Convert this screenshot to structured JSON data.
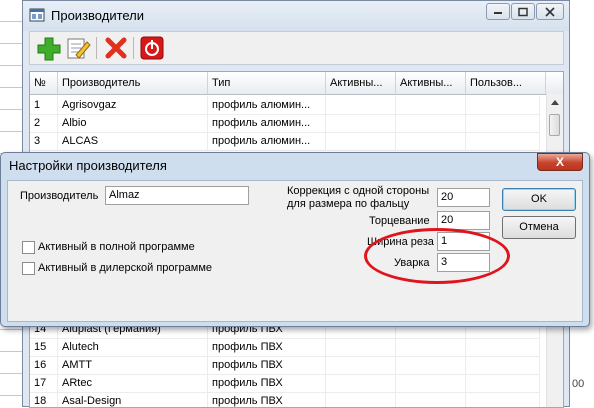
{
  "main_window": {
    "title": "Производители",
    "colors": {
      "title_bar": "#dfe8f2",
      "dialog_close": "#c7432c",
      "highlight_ellipse": "#e0141c"
    },
    "toolbar": {
      "buttons": [
        {
          "name": "add-icon"
        },
        {
          "name": "edit-icon"
        },
        {
          "name": "delete-icon"
        },
        {
          "name": "power-icon"
        }
      ]
    },
    "grid": {
      "columns": [
        "№",
        "Производитель",
        "Тип",
        "Активны...",
        "Активны...",
        "Пользов..."
      ],
      "rows_top": [
        {
          "num": "1",
          "name": "Agrisovgaz",
          "type": "профиль алюмин..."
        },
        {
          "num": "2",
          "name": "Albio",
          "type": "профиль алюмин..."
        },
        {
          "num": "3",
          "name": "ALCAS",
          "type": "профиль алюмин..."
        }
      ],
      "rows_bottom": [
        {
          "num": "14",
          "name": "Aluplast (Германия)",
          "type": "профиль ПВХ"
        },
        {
          "num": "15",
          "name": "Alutech",
          "type": "профиль ПВХ"
        },
        {
          "num": "16",
          "name": "AMTT",
          "type": "профиль ПВХ"
        },
        {
          "num": "17",
          "name": "ARtec",
          "type": "профиль ПВХ"
        },
        {
          "num": "18",
          "name": "Asal-Design",
          "type": "профиль ПВХ"
        }
      ]
    }
  },
  "background": {
    "right_number": "00"
  },
  "dialog": {
    "title": "Настройки производителя",
    "close_label": "X",
    "producer_label": "Производитель",
    "producer_value": "Almaz",
    "correction_label_1": "Коррекция с одной стороны",
    "correction_label_2": "для размера по фальцу",
    "correction_value": "20",
    "trim_label": "Торцевание",
    "trim_value": "20",
    "width_label": "Ширина реза",
    "width_value": "1",
    "shrink_label": "Уварка",
    "shrink_value": "3",
    "active_full_label": "Активный в полной программе",
    "active_dealer_label": "Активный в дилерской программе",
    "ok_label": "OK",
    "cancel_label": "Отмена"
  }
}
